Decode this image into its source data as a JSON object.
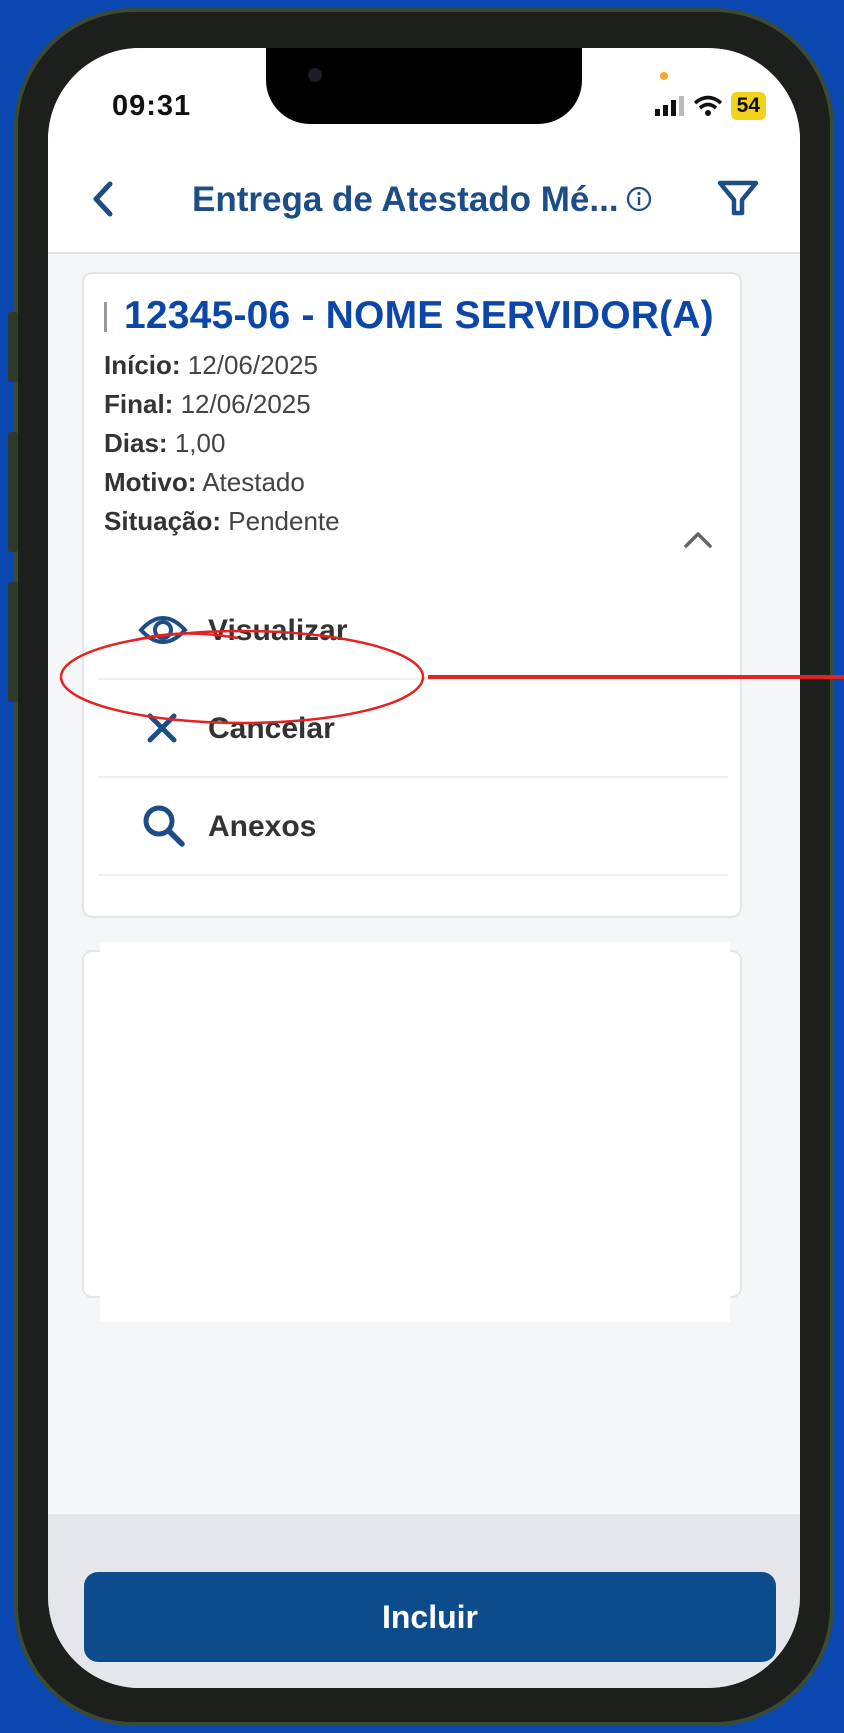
{
  "status_bar": {
    "time": "09:31",
    "battery": "54"
  },
  "header": {
    "title": "Entrega de Atestado Mé..."
  },
  "record": {
    "title": "12345-06 - NOME SERVIDOR(A)",
    "fields": [
      {
        "label": "Início:",
        "value": "12/06/2025"
      },
      {
        "label": "Final:",
        "value": "12/06/2025"
      },
      {
        "label": "Dias:",
        "value": "1,00"
      },
      {
        "label": "Motivo:",
        "value": "Atestado"
      },
      {
        "label": "Situação:",
        "value": "Pendente"
      }
    ]
  },
  "actions": [
    {
      "label": "Visualizar",
      "icon": "eye-icon"
    },
    {
      "label": "Cancelar",
      "icon": "close-icon"
    },
    {
      "label": "Anexos",
      "icon": "search-icon"
    }
  ],
  "footer": {
    "primary_button": "Incluir"
  },
  "colors": {
    "primary": "#0c4c8c",
    "title": "#0b46a8",
    "annotation": "#e32222",
    "background": "#0a47b0"
  }
}
